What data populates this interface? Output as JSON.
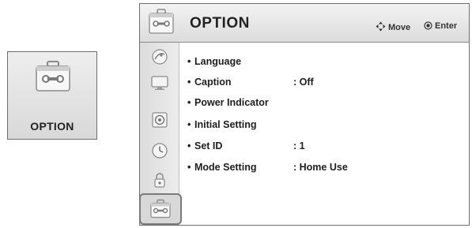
{
  "tile": {
    "label": "OPTION",
    "icon": "toolbox-icon"
  },
  "panel": {
    "title": "OPTION",
    "hints": {
      "move": "Move",
      "enter": "Enter"
    },
    "sidebar": [
      {
        "icon": "satellite-dish-icon"
      },
      {
        "icon": "tv-screen-icon"
      },
      {
        "icon": "speaker-icon"
      },
      {
        "icon": "clock-icon"
      },
      {
        "icon": "lock-icon"
      },
      {
        "icon": "toolbox-icon",
        "selected": true
      }
    ],
    "items": [
      {
        "bullet": "•",
        "label": "Language",
        "value": ""
      },
      {
        "bullet": "•",
        "label": "Caption",
        "value": ": Off"
      },
      {
        "bullet": "•",
        "label": "Power Indicator",
        "value": ""
      },
      {
        "bullet": "•",
        "label": "Initial Setting",
        "value": ""
      },
      {
        "bullet": "•",
        "label": "Set ID",
        "value": ": 1"
      },
      {
        "bullet": "•",
        "label": "Mode Setting",
        "value": ": Home Use"
      }
    ]
  }
}
